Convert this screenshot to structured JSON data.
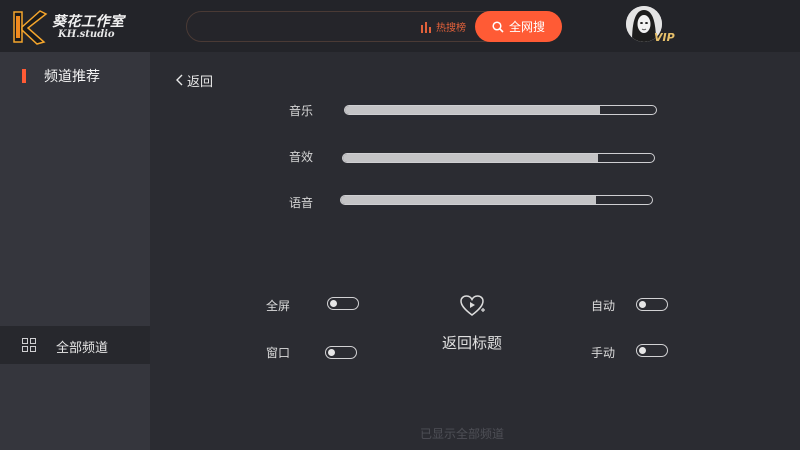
{
  "header": {
    "logo_title": "葵花工作室",
    "logo_subtitle": "KH.studio",
    "hot_label": "热搜榜",
    "search_button": "全网搜",
    "vip_badge": "VIP",
    "accent_color": "#ff5b35"
  },
  "sidebar": {
    "recommended": "频道推荐",
    "all_channels": "全部频道"
  },
  "main": {
    "back_label": "返回",
    "volumes": [
      {
        "label": "音乐",
        "level": 0.82
      },
      {
        "label": "音效",
        "level": 0.82
      },
      {
        "label": "语音",
        "level": 0.82
      }
    ],
    "display_options": {
      "fullscreen": "全屏",
      "window": "窗口"
    },
    "mode_options": {
      "auto": "自动",
      "manual": "手动"
    },
    "return_title": "返回标题",
    "footer_note": "已显示全部频道"
  },
  "icons": {
    "logo": "k-logo-icon",
    "hot": "bar-chart-icon",
    "search": "search-icon",
    "back": "chevron-left-icon",
    "grid": "grid-icon",
    "heart": "heart-play-icon"
  }
}
